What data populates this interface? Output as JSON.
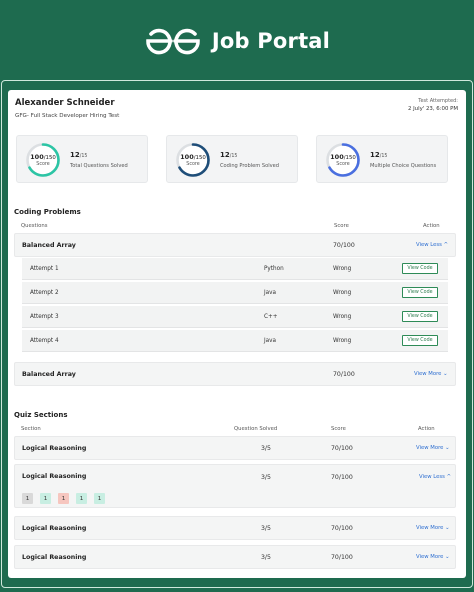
{
  "brand": {
    "title": "Job Portal"
  },
  "header": {
    "candidate_name": "Alexander Schneider",
    "test_name": "GFG- Full Stack Developer Hiring Test",
    "attempted_label": "Test Attempted:",
    "attempted_date": "2 July' 23, 6:00 PM"
  },
  "stats": [
    {
      "score_value": "100",
      "score_total": "/150",
      "score_label": "Score",
      "count": "12",
      "count_total": "/15",
      "description": "Total Questions Solved",
      "color": "#2cc5a5",
      "fraction": 0.667
    },
    {
      "score_value": "100",
      "score_total": "/150",
      "score_label": "Score",
      "count": "12",
      "count_total": "/15",
      "description": "Coding Problem Solved",
      "color": "#1f4e79",
      "fraction": 0.667
    },
    {
      "score_value": "100",
      "score_total": "/150",
      "score_label": "Score",
      "count": "12",
      "count_total": "/15",
      "description": "Multiple Choice Questions",
      "color": "#4a6fe0",
      "fraction": 0.667
    }
  ],
  "coding": {
    "title": "Coding Problems",
    "columns": {
      "questions": "Questions",
      "score": "Score",
      "action": "Action"
    },
    "problems": [
      {
        "name": "Balanced Array",
        "score": "70/100",
        "action": "View Less",
        "chevron": "^"
      },
      {
        "name": "Balanced Array",
        "score": "70/100",
        "action": "View More",
        "chevron": "⌄"
      }
    ],
    "attempts": [
      {
        "label": "Attempt 1",
        "language": "Python",
        "result": "Wrong",
        "button": "View Code"
      },
      {
        "label": "Attempt 2",
        "language": "Java",
        "result": "Wrong",
        "button": "View Code"
      },
      {
        "label": "Attempt 3",
        "language": "C++",
        "result": "Wrong",
        "button": "View Code"
      },
      {
        "label": "Attempt 4",
        "language": "Java",
        "result": "Wrong",
        "button": "View Code"
      }
    ]
  },
  "quiz": {
    "title": "Quiz Sections",
    "columns": {
      "section": "Section",
      "solved": "Question Solved",
      "score": "Score",
      "action": "Action"
    },
    "sections": [
      {
        "name": "Logical Reasoning",
        "solved": "3/5",
        "score": "70/100",
        "action": "View More",
        "chevron": "⌄"
      },
      {
        "name": "Logical Reasoning",
        "solved": "3/5",
        "score": "70/100",
        "action": "View Less",
        "chevron": "^"
      },
      {
        "name": "Logical Reasoning",
        "solved": "3/5",
        "score": "70/100",
        "action": "View More",
        "chevron": "⌄"
      },
      {
        "name": "Logical Reasoning",
        "solved": "3/5",
        "score": "70/100",
        "action": "View More",
        "chevron": "⌄"
      }
    ],
    "chips": [
      {
        "label": "1",
        "status": "neutral",
        "color": "#d9d9d9"
      },
      {
        "label": "1",
        "status": "correct",
        "color": "#c8eee2"
      },
      {
        "label": "1",
        "status": "wrong",
        "color": "#f6c6bf"
      },
      {
        "label": "1",
        "status": "correct",
        "color": "#c8eee2"
      },
      {
        "label": "1",
        "status": "correct",
        "color": "#c8eee2"
      }
    ]
  },
  "colors": {
    "brand_bg": "#1e6b4f",
    "link": "#2a6cd0",
    "button_border": "#2e8b57"
  }
}
